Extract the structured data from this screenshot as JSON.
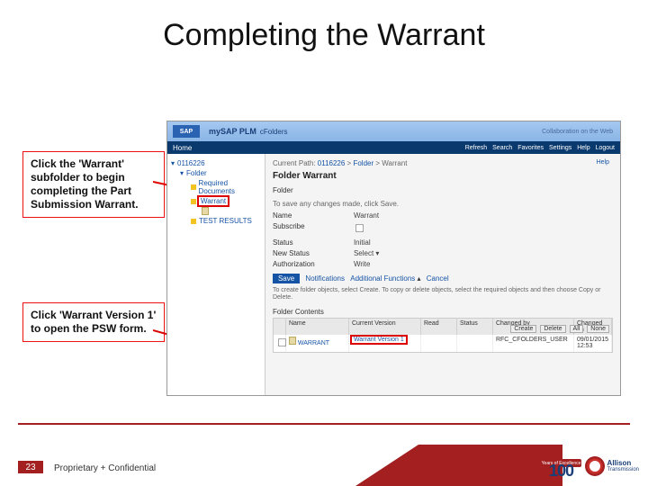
{
  "title": "Completing the Warrant",
  "callout1": "Click the 'Warrant' subfolder to begin completing the Part Submission Warrant.",
  "callout2": "Click 'Warrant Version 1' to open the PSW form.",
  "sap": {
    "logo": "SAP",
    "product1": "mySAP PLM",
    "product2": "cFolders",
    "collab": "Collaboration on the Web",
    "home": "Home",
    "navlinks": "Refresh   Search   Favorites   Settings   Help   Logout",
    "help": "Help"
  },
  "tree": {
    "root": "0116226",
    "folder": "Folder",
    "docs": "Required Documents",
    "warrant": "Warrant",
    "tests": "TEST RESULTS"
  },
  "right": {
    "crumb_label": "Current Path:",
    "crumb1": "0116226",
    "crumb2": "Folder",
    "crumb3": "Warrant",
    "heading": "Folder Warrant",
    "sub": "Folder",
    "hint": "To save any changes made, click Save.",
    "fields": {
      "name_l": "Name",
      "name_v": "Warrant",
      "subs_l": "Subscribe",
      "subs_v": "",
      "status_l": "Status",
      "status_v": "Initial",
      "newstatus_l": "New Status",
      "newstatus_v": "Select",
      "auth_l": "Authorization",
      "auth_v": "Write"
    },
    "btn_save": "Save",
    "btn_notif": "Notifications",
    "btn_addl": "Additional Functions",
    "btn_cancel": "Cancel",
    "tip": "To create folder objects, select Create. To copy or delete objects, select the required objects and then choose Copy or Delete.",
    "contents": "Folder Contents",
    "mini": {
      "create": "Create",
      "delete": "Delete",
      "all": "All",
      "none": "None"
    },
    "thead": {
      "name": "Name",
      "ver": "Current Version",
      "read": "Read",
      "status": "Status",
      "chby": "Changed by",
      "chon": "Changed on"
    },
    "row": {
      "name": "WARRANT",
      "ver": "Warrant Version 1",
      "chby": "RFC_CFOLDERS_USER",
      "chon": "09/01/2015 12:53"
    }
  },
  "footer": {
    "page": "23",
    "confid": "Proprietary + Confidential",
    "years": "Years of Excellence",
    "hundred": "100",
    "brand1": "Allison",
    "brand2": "Transmission"
  }
}
